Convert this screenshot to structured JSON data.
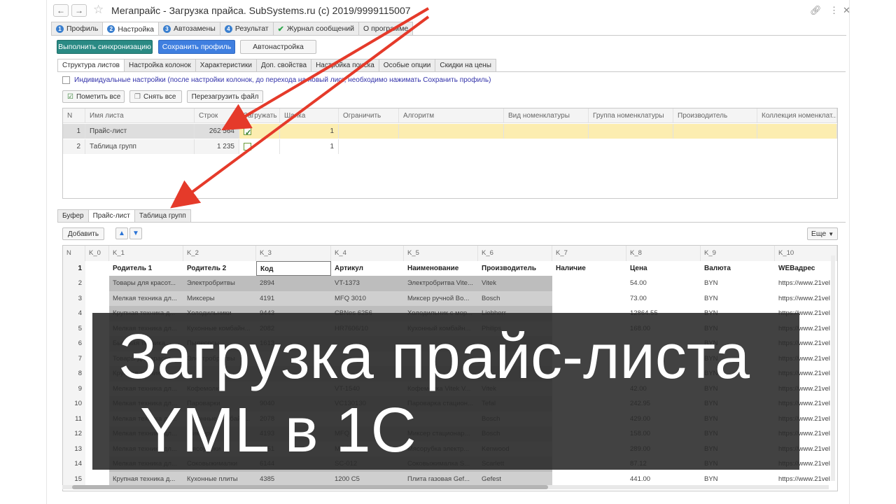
{
  "window": {
    "title": "Мегапрайс - Загрузка прайса. SubSystems.ru (c) 2019/9999115007"
  },
  "toptabs": [
    {
      "num": "1",
      "label": "Профиль"
    },
    {
      "num": "2",
      "label": "Настройка"
    },
    {
      "num": "3",
      "label": "Автозамены"
    },
    {
      "num": "4",
      "label": "Результат"
    },
    {
      "num": "",
      "label": "Журнал сообщений"
    },
    {
      "num": "",
      "label": "О программе"
    }
  ],
  "actions": {
    "sync": "Выполнить синхронизацию",
    "save": "Сохранить профиль",
    "auto": "Автонастройка"
  },
  "subtabs": [
    "Структура листов",
    "Настройка колонок",
    "Характеристики",
    "Доп. свойства",
    "Настройка поиска",
    "Особые опции",
    "Скидки на цены"
  ],
  "individual": "Индивидуальные настройки (после настройки колонок, до перехода на новый лист, необходимо нажимать Сохранить профиль)",
  "buttons": {
    "mark_all": "Пометить все",
    "unmark_all": "Снять все",
    "reload": "Перезагрузить файл",
    "add": "Добавить",
    "more": "Еще"
  },
  "sheets_grid": {
    "headers": [
      "N",
      "Имя листа",
      "Строк",
      "Загружать",
      "Шапка",
      "Ограничить",
      "Алгоритм",
      "Вид номенклатуры",
      "Группа номенклатуры",
      "Производитель",
      "Коллекция номенклат..."
    ],
    "rows": [
      {
        "n": "1",
        "name": "Прайс-лист",
        "rows": "262 564",
        "load": true,
        "head": "1"
      },
      {
        "n": "2",
        "name": "Таблица групп",
        "rows": "1 235",
        "load": false,
        "head": "1"
      }
    ]
  },
  "lowtabs": [
    "Буфер",
    "Прайс-лист",
    "Таблица групп"
  ],
  "data_grid": {
    "headers": [
      "N",
      "K_0",
      "K_1",
      "K_2",
      "K_3",
      "K_4",
      "K_5",
      "K_6",
      "K_7",
      "K_8",
      "K_9",
      "K_10"
    ],
    "rows": [
      [
        "1",
        "",
        "Родитель 1",
        "Родитель 2",
        "Код",
        "Артикул",
        "Наименование",
        "Производитель",
        "Наличие",
        "Цена",
        "Валюта",
        "WEBадрес"
      ],
      [
        "2",
        "",
        "Товары для красот...",
        "Электробритвы",
        "2894",
        "VT-1373",
        "Электробритва Vite...",
        "Vitek",
        "",
        "54.00",
        "BYN",
        "https://www.21vel"
      ],
      [
        "3",
        "",
        "Мелкая техника дл...",
        "Миксеры",
        "4191",
        "MFQ 3010",
        "Миксер ручной Bo...",
        "Bosch",
        "",
        "73.00",
        "BYN",
        "https://www.21vel"
      ],
      [
        "4",
        "",
        "Крупная техника д...",
        "Холодильники",
        "9443",
        "CBNes 6256",
        "Холодильник с мор...",
        "Liebherr",
        "",
        "12864.55",
        "BYN",
        "https://www.21vel"
      ],
      [
        "5",
        "",
        "Мелкая техника дл...",
        "Кухонные комбайн...",
        "2082",
        "HR7606/10",
        "Кухонный комбайн...",
        "Philips",
        "",
        "168.00",
        "BYN",
        "https://www.21vel"
      ],
      [
        "6",
        "",
        "Бытовая техника...",
        "Пылесосы",
        "1613",
        "",
        "",
        "",
        "",
        "",
        "BYN",
        "https://www.21vel"
      ],
      [
        "7",
        "",
        "Товары для красот...",
        "Электробритвы",
        "",
        "",
        "",
        "",
        "",
        "",
        "BYN",
        "https://www.21vel"
      ],
      [
        "8",
        "",
        "Крупная техника...",
        "",
        "",
        "",
        "",
        "",
        "",
        "",
        "BYN",
        "https://www.21vel"
      ],
      [
        "9",
        "",
        "Мелкая техника дл...",
        "Кофемолки",
        "",
        "VT-1540",
        "Кофемолка Vitek V...",
        "Vitek",
        "",
        "42.00",
        "BYN",
        "https://www.21vel"
      ],
      [
        "10",
        "",
        "Мелкая техника дл...",
        "Пароварки",
        "9040",
        "VC130130",
        "Пароварка стацион...",
        "Tefal",
        "",
        "242.95",
        "BYN",
        "https://www.21vel"
      ],
      [
        "11",
        "",
        "Мелкая техника дл...",
        "Кухонные комбайн...",
        "2078",
        "",
        "",
        "Bosch",
        "",
        "429.00",
        "BYN",
        "https://www.21vel"
      ],
      [
        "12",
        "",
        "Мелкая техника дл...",
        "Миксеры",
        "4193",
        "MFQ 3",
        "Миксер стационар...",
        "Bosch",
        "",
        "158.00",
        "BYN",
        "https://www.21vel"
      ],
      [
        "13",
        "",
        "Мелкая техника дл...",
        "Мясорубки",
        "6151",
        "MG45",
        "Мясорубка электр...",
        "Kenwood",
        "",
        "289.00",
        "BYN",
        "https://www.21vel"
      ],
      [
        "14",
        "",
        "Мелкая техника дл...",
        "Соковыжималки",
        "6144",
        "SC-012",
        "Соковыжималка S...",
        "Scarlett",
        "",
        "87.12",
        "BYN",
        "https://www.21vel"
      ],
      [
        "15",
        "",
        "Крупная техника д...",
        "Кухонные плиты",
        "4385",
        "1200 C5",
        "Плита газовая Gef...",
        "Gefest",
        "",
        "441.00",
        "BYN",
        "https://www.21vel"
      ]
    ]
  },
  "banner": {
    "line1": "Загрузка прайс-листа",
    "line2": "YML в 1С"
  },
  "colors": {
    "accent_red": "#e53a2a",
    "sync_button": "#2a8a84",
    "save_button": "#3f7fe0",
    "selected_row": "#fcedb0"
  }
}
